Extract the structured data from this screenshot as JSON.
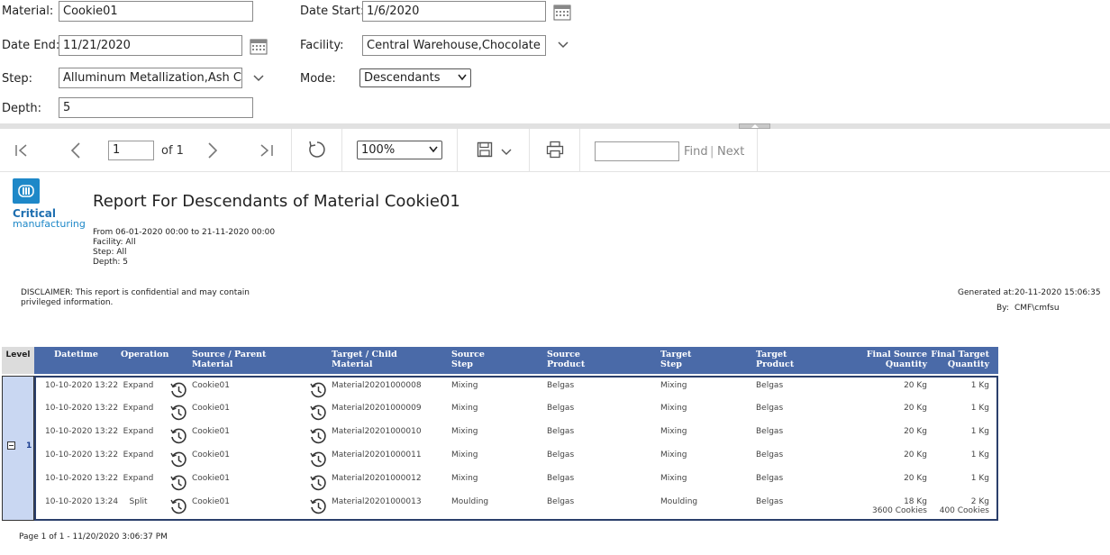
{
  "params": {
    "material_label": "Material:",
    "material_value": "Cookie01",
    "date_start_label": "Date Start:",
    "date_start_value": "1/6/2020",
    "date_end_label": "Date End:",
    "date_end_value": "11/21/2020",
    "facility_label": "Facility:",
    "facility_value": "Central Warehouse,Chocolate Fac",
    "step_label": "Step:",
    "step_value": "Alluminum Metallization,Ash Clea",
    "mode_label": "Mode:",
    "mode_value": "Descendants",
    "depth_label": "Depth:",
    "depth_value": "5"
  },
  "toolbar": {
    "page_value": "1",
    "page_of": "of 1",
    "zoom_value": "100%",
    "find_label": "Find",
    "find_sep": "|",
    "next_label": "Next",
    "icons": [
      "first-page-icon",
      "prev-page-icon",
      "next-page-icon",
      "last-page-icon",
      "refresh-icon",
      "save-icon",
      "print-icon"
    ]
  },
  "report": {
    "logo_line1": "Critical",
    "logo_line2": "manufacturing",
    "title": "Report For Descendants of Material Cookie01",
    "range_line": "From 06-01-2020 00:00 to 21-11-2020 00:00",
    "facility_line": "Facility: All",
    "step_line": "Step: All",
    "depth_line": "Depth: 5",
    "disclaimer_line1": "DISCLAIMER: This report is confidential and may contain",
    "disclaimer_line2": "privileged information.",
    "generated_label": "Generated at:",
    "generated_value": "20-11-2020 15:06:35",
    "by_label": "By:",
    "by_value": "CMF\\cmfsu",
    "footer": "Page 1 of 1 - 11/20/2020 3:06:37 PM",
    "level_header": "Level",
    "level_value": "1",
    "columns": {
      "datetime": "Datetime",
      "operation": "Operation",
      "source_parent_1": "Source / Parent",
      "source_parent_2": "Material",
      "target_child_1": "Target / Child",
      "target_child_2": "Material",
      "source_step_1": "Source",
      "source_step_2": "Step",
      "source_product_1": "Source",
      "source_product_2": "Product",
      "target_step_1": "Target",
      "target_step_2": "Step",
      "target_product_1": "Target",
      "target_product_2": "Product",
      "final_source_1": "Final Source",
      "final_source_2": "Quantity",
      "final_target_1": "Final Target",
      "final_target_2": "Quantity"
    },
    "rows": [
      {
        "datetime": "10-10-2020 13:22",
        "operation": "Expand",
        "source": "Cookie01",
        "target": "Material20201000008",
        "source_step": "Mixing",
        "source_product": "Belgas",
        "target_step": "Mixing",
        "target_product": "Belgas",
        "final_source": "20 Kg",
        "final_source_2": "",
        "final_target": "1 Kg",
        "final_target_2": ""
      },
      {
        "datetime": "10-10-2020 13:22",
        "operation": "Expand",
        "source": "Cookie01",
        "target": "Material20201000009",
        "source_step": "Mixing",
        "source_product": "Belgas",
        "target_step": "Mixing",
        "target_product": "Belgas",
        "final_source": "20 Kg",
        "final_source_2": "",
        "final_target": "1 Kg",
        "final_target_2": ""
      },
      {
        "datetime": "10-10-2020 13:22",
        "operation": "Expand",
        "source": "Cookie01",
        "target": "Material20201000010",
        "source_step": "Mixing",
        "source_product": "Belgas",
        "target_step": "Mixing",
        "target_product": "Belgas",
        "final_source": "20 Kg",
        "final_source_2": "",
        "final_target": "1 Kg",
        "final_target_2": ""
      },
      {
        "datetime": "10-10-2020 13:22",
        "operation": "Expand",
        "source": "Cookie01",
        "target": "Material20201000011",
        "source_step": "Mixing",
        "source_product": "Belgas",
        "target_step": "Mixing",
        "target_product": "Belgas",
        "final_source": "20 Kg",
        "final_source_2": "",
        "final_target": "1 Kg",
        "final_target_2": ""
      },
      {
        "datetime": "10-10-2020 13:22",
        "operation": "Expand",
        "source": "Cookie01",
        "target": "Material20201000012",
        "source_step": "Mixing",
        "source_product": "Belgas",
        "target_step": "Mixing",
        "target_product": "Belgas",
        "final_source": "20 Kg",
        "final_source_2": "",
        "final_target": "1 Kg",
        "final_target_2": ""
      },
      {
        "datetime": "10-10-2020 13:24",
        "operation": "Split",
        "source": "Cookie01",
        "target": "Material20201000013",
        "source_step": "Moulding",
        "source_product": "Belgas",
        "target_step": "Moulding",
        "target_product": "Belgas",
        "final_source": "18 Kg",
        "final_source_2": "3600 Cookies",
        "final_target": "2 Kg",
        "final_target_2": "400 Cookies"
      }
    ]
  }
}
